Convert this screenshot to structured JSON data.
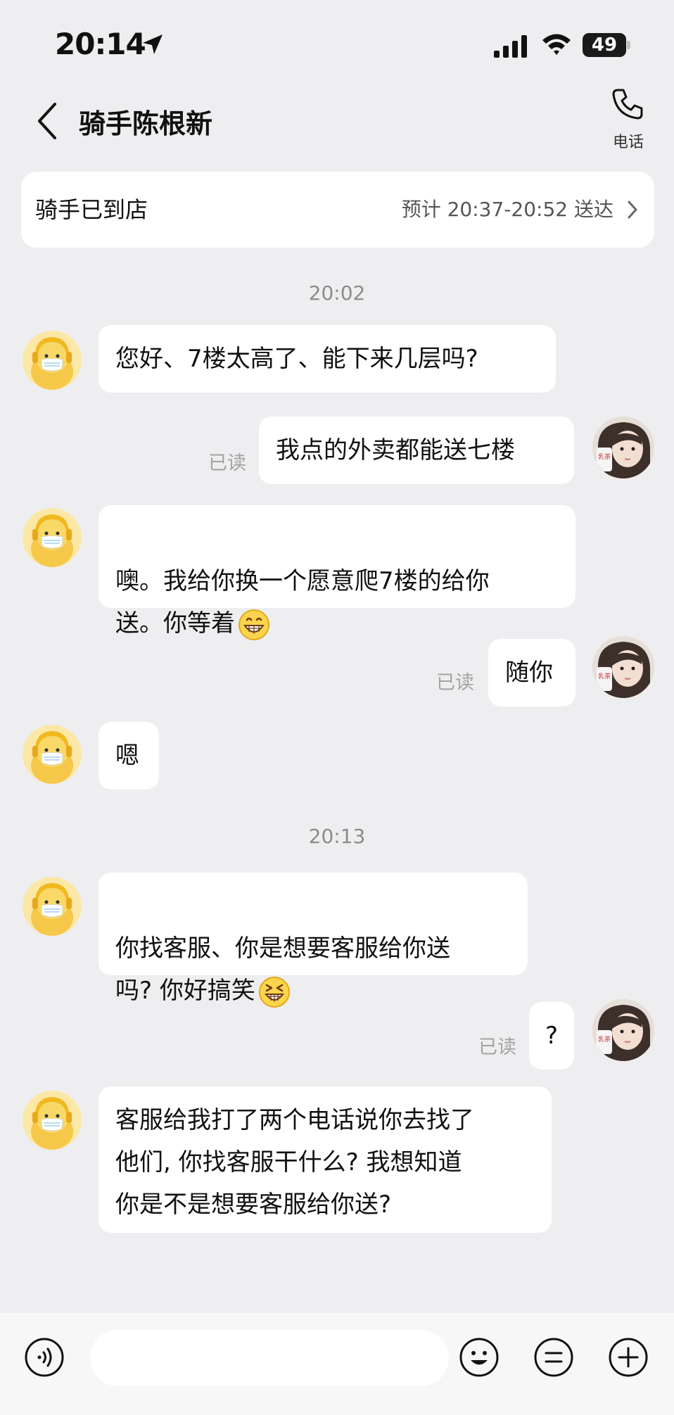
{
  "status_bar": {
    "time": "20:14",
    "battery": "49"
  },
  "header": {
    "title": "骑手陈根新",
    "phone_label": "电话"
  },
  "order_banner": {
    "status": "骑手已到店",
    "eta": "预计 20:37-20:52 送达"
  },
  "timestamps": [
    "20:02",
    "20:13"
  ],
  "messages": [
    {
      "sender": "rider",
      "text": "您好、7楼太高了、能下来几层吗?"
    },
    {
      "sender": "user",
      "text": "我点的外卖都能送七楼",
      "status": "已读"
    },
    {
      "sender": "rider",
      "text": "噢。我给你换一个愿意爬7楼的给你\n送。你等着",
      "emoji": "grin-emoji"
    },
    {
      "sender": "user",
      "text": "随你",
      "status": "已读"
    },
    {
      "sender": "rider",
      "text": "嗯"
    },
    {
      "sender": "rider",
      "text": "你找客服、你是想要客服给你送\n吗? 你好搞笑",
      "emoji": "laughing-emoji"
    },
    {
      "sender": "user",
      "text": "?",
      "status": "已读"
    },
    {
      "sender": "rider",
      "text": "客服给我打了两个电话说你去找了\n他们, 你找客服干什么? 我想知道\n你是不是想要客服给你送?"
    }
  ],
  "input_bar": {
    "placeholder": "",
    "icons": [
      "voice-icon",
      "emoji-icon",
      "quick-reply-icon",
      "plus-icon"
    ]
  },
  "colors": {
    "background": "#eeeef0",
    "bubble": "#ffffff",
    "rider_avatar": "#f6d661",
    "read_text": "#a3a3a3"
  }
}
